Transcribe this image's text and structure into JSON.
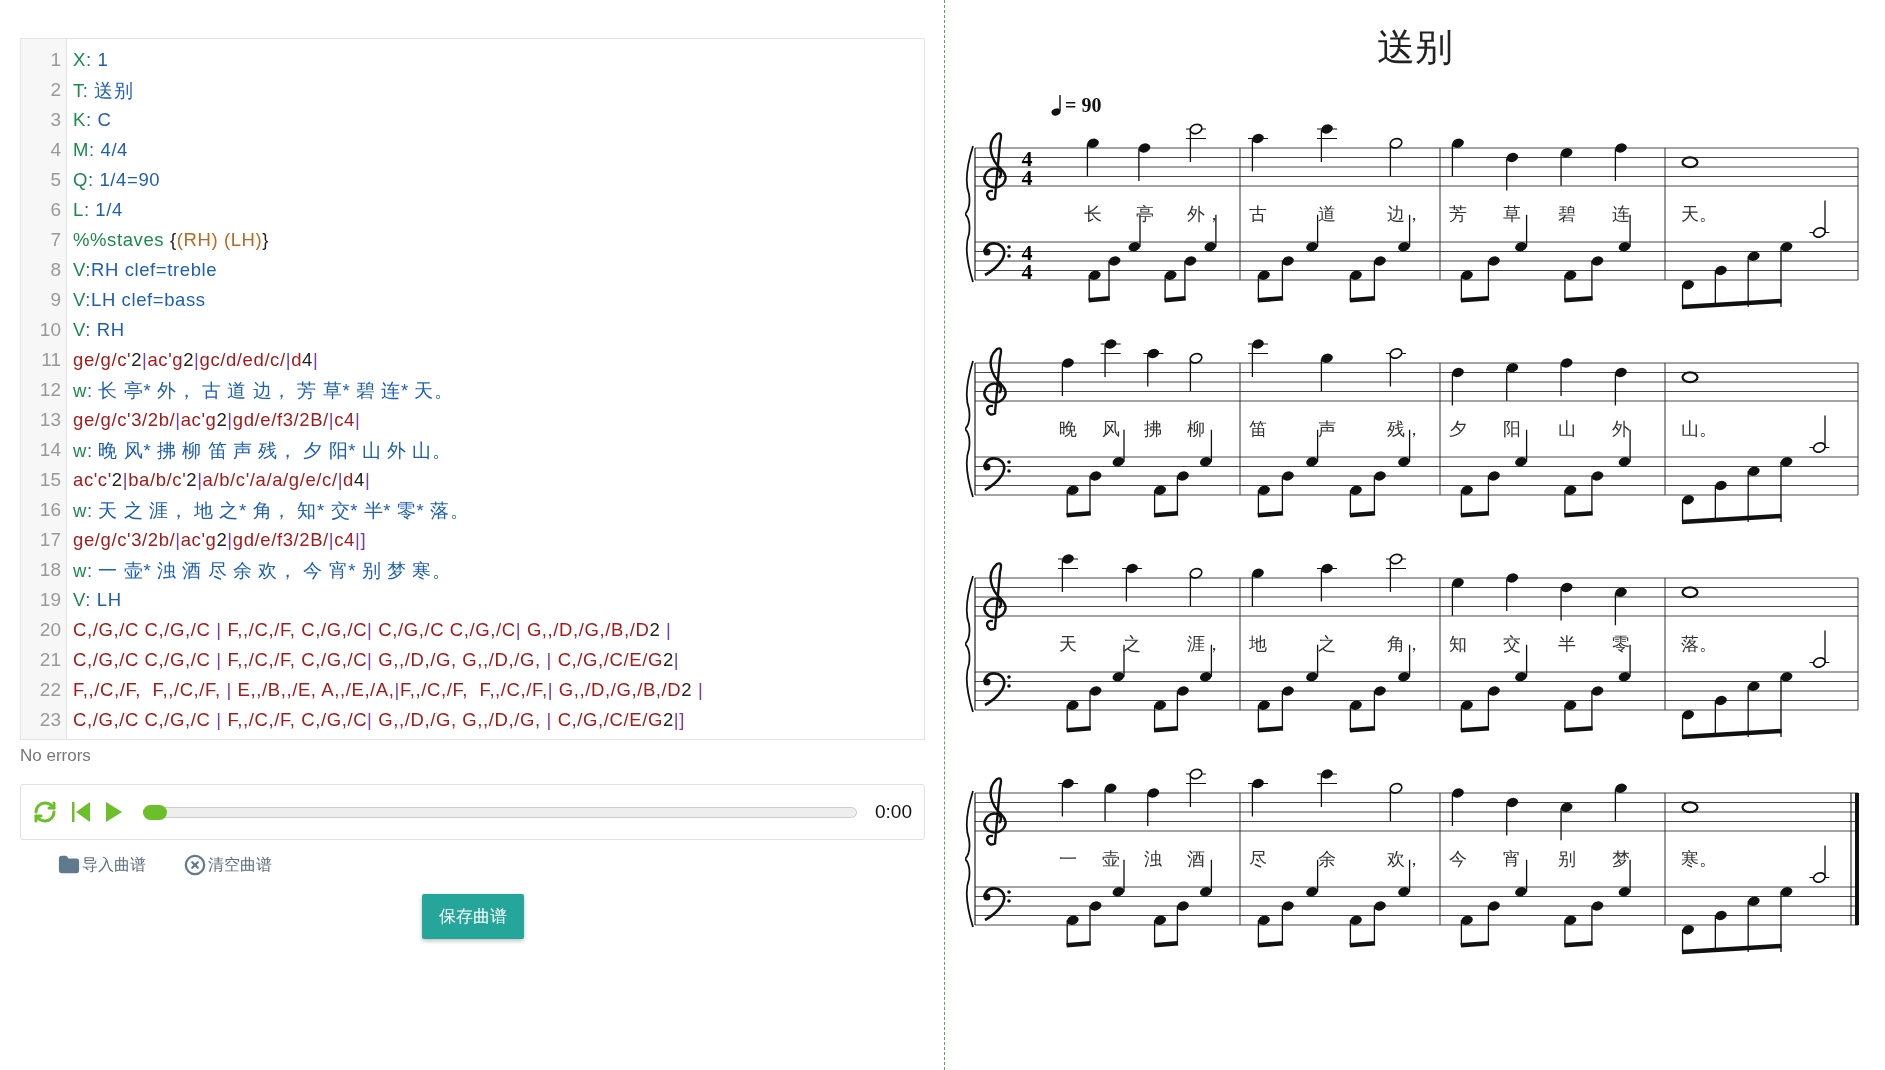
{
  "editor": {
    "lines": [
      {
        "number": "1",
        "segments": [
          {
            "kind": "key",
            "text": "X"
          },
          {
            "kind": "value",
            "text": ": 1"
          }
        ]
      },
      {
        "number": "2",
        "segments": [
          {
            "kind": "key",
            "text": "T"
          },
          {
            "kind": "value",
            "text": ": 送别"
          }
        ]
      },
      {
        "number": "3",
        "segments": [
          {
            "kind": "key",
            "text": "K"
          },
          {
            "kind": "value",
            "text": ": C"
          }
        ]
      },
      {
        "number": "4",
        "segments": [
          {
            "kind": "key",
            "text": "M"
          },
          {
            "kind": "value",
            "text": ": 4/4"
          }
        ]
      },
      {
        "number": "5",
        "segments": [
          {
            "kind": "key",
            "text": "Q"
          },
          {
            "kind": "value",
            "text": ": 1/4=90"
          }
        ]
      },
      {
        "number": "6",
        "segments": [
          {
            "kind": "key",
            "text": "L"
          },
          {
            "kind": "value",
            "text": ": 1/4"
          }
        ]
      },
      {
        "number": "7",
        "segments": [
          {
            "kind": "key",
            "text": "%%staves"
          },
          {
            "kind": "plain",
            "text": " {"
          },
          {
            "kind": "voice",
            "text": "(RH) (LH)"
          },
          {
            "kind": "plain",
            "text": "}"
          }
        ]
      },
      {
        "number": "8",
        "segments": [
          {
            "kind": "key",
            "text": "V"
          },
          {
            "kind": "value",
            "text": ":RH clef=treble"
          }
        ]
      },
      {
        "number": "9",
        "segments": [
          {
            "kind": "key",
            "text": "V"
          },
          {
            "kind": "value",
            "text": ":LH clef=bass"
          }
        ]
      },
      {
        "number": "10",
        "segments": [
          {
            "kind": "key",
            "text": "V"
          },
          {
            "kind": "value",
            "text": ": RH"
          }
        ]
      },
      {
        "number": "11",
        "segments": [
          {
            "kind": "note",
            "text": "ge/g/c'"
          },
          {
            "kind": "plain",
            "text": "2"
          },
          {
            "kind": "bar",
            "text": "|"
          },
          {
            "kind": "note",
            "text": "ac'g"
          },
          {
            "kind": "plain",
            "text": "2"
          },
          {
            "kind": "bar",
            "text": "|"
          },
          {
            "kind": "note",
            "text": "gc/d/ed/c/"
          },
          {
            "kind": "bar",
            "text": "|"
          },
          {
            "kind": "note",
            "text": "d"
          },
          {
            "kind": "plain",
            "text": "4"
          },
          {
            "kind": "bar",
            "text": "|"
          }
        ]
      },
      {
        "number": "12",
        "segments": [
          {
            "kind": "key",
            "text": "w"
          },
          {
            "kind": "value",
            "text": ": 长 亭* 外， 古 道 边， 芳 草* 碧 连* 天。"
          }
        ]
      },
      {
        "number": "13",
        "segments": [
          {
            "kind": "note",
            "text": "ge/g/c'3/2b/"
          },
          {
            "kind": "bar",
            "text": "|"
          },
          {
            "kind": "note",
            "text": "ac'g"
          },
          {
            "kind": "plain",
            "text": "2"
          },
          {
            "kind": "bar",
            "text": "|"
          },
          {
            "kind": "note",
            "text": "gd/e/f3/2B/"
          },
          {
            "kind": "bar",
            "text": "|"
          },
          {
            "kind": "note",
            "text": "c4"
          },
          {
            "kind": "bar",
            "text": "|"
          }
        ]
      },
      {
        "number": "14",
        "segments": [
          {
            "kind": "key",
            "text": "w"
          },
          {
            "kind": "value",
            "text": ": 晚 风* 拂 柳 笛 声 残， 夕 阳* 山 外 山。"
          }
        ]
      },
      {
        "number": "15",
        "segments": [
          {
            "kind": "note",
            "text": "ac'c'"
          },
          {
            "kind": "plain",
            "text": "2"
          },
          {
            "kind": "bar",
            "text": "|"
          },
          {
            "kind": "note",
            "text": "ba/b/c'"
          },
          {
            "kind": "plain",
            "text": "2"
          },
          {
            "kind": "bar",
            "text": "|"
          },
          {
            "kind": "note",
            "text": "a/b/c'/a/a/g/e/c/"
          },
          {
            "kind": "bar",
            "text": "|"
          },
          {
            "kind": "note",
            "text": "d"
          },
          {
            "kind": "plain",
            "text": "4"
          },
          {
            "kind": "bar",
            "text": "|"
          }
        ]
      },
      {
        "number": "16",
        "segments": [
          {
            "kind": "key",
            "text": "w"
          },
          {
            "kind": "value",
            "text": ": 天 之 涯， 地 之* 角， 知* 交* 半* 零* 落。"
          }
        ]
      },
      {
        "number": "17",
        "segments": [
          {
            "kind": "note",
            "text": "ge/g/c'3/2b/"
          },
          {
            "kind": "bar",
            "text": "|"
          },
          {
            "kind": "note",
            "text": "ac'g"
          },
          {
            "kind": "plain",
            "text": "2"
          },
          {
            "kind": "bar",
            "text": "|"
          },
          {
            "kind": "note",
            "text": "gd/e/f3/2B/"
          },
          {
            "kind": "bar",
            "text": "|"
          },
          {
            "kind": "note",
            "text": "c4"
          },
          {
            "kind": "bar",
            "text": "|]"
          }
        ]
      },
      {
        "number": "18",
        "segments": [
          {
            "kind": "key",
            "text": "w"
          },
          {
            "kind": "value",
            "text": ": 一 壶* 浊 酒 尽 余 欢， 今 宵* 别 梦 寒。"
          }
        ]
      },
      {
        "number": "19",
        "segments": [
          {
            "kind": "key",
            "text": "V"
          },
          {
            "kind": "value",
            "text": ": LH"
          }
        ]
      },
      {
        "number": "20",
        "segments": [
          {
            "kind": "note",
            "text": "C,/G,/C C,/G,/C "
          },
          {
            "kind": "bar",
            "text": "|"
          },
          {
            "kind": "note",
            "text": " F,,/C,/F, C,/G,/C"
          },
          {
            "kind": "bar",
            "text": "|"
          },
          {
            "kind": "note",
            "text": " C,/G,/C C,/G,/C"
          },
          {
            "kind": "bar",
            "text": "|"
          },
          {
            "kind": "note",
            "text": " G,,/D,/G,/B,/D"
          },
          {
            "kind": "plain",
            "text": "2 "
          },
          {
            "kind": "bar",
            "text": "|"
          }
        ]
      },
      {
        "number": "21",
        "segments": [
          {
            "kind": "note",
            "text": "C,/G,/C C,/G,/C "
          },
          {
            "kind": "bar",
            "text": "|"
          },
          {
            "kind": "note",
            "text": " F,,/C,/F, C,/G,/C"
          },
          {
            "kind": "bar",
            "text": "|"
          },
          {
            "kind": "note",
            "text": " G,,/D,/G, G,,/D,/G, "
          },
          {
            "kind": "bar",
            "text": "|"
          },
          {
            "kind": "note",
            "text": " C,/G,/C/E/G"
          },
          {
            "kind": "plain",
            "text": "2"
          },
          {
            "kind": "bar",
            "text": "|"
          }
        ]
      },
      {
        "number": "22",
        "segments": [
          {
            "kind": "note",
            "text": "F,,/C,/F,  F,,/C,/F, "
          },
          {
            "kind": "bar",
            "text": "|"
          },
          {
            "kind": "note",
            "text": " E,,/B,,/E, A,,/E,/A,"
          },
          {
            "kind": "bar",
            "text": "|"
          },
          {
            "kind": "note",
            "text": "F,,/C,/F,  F,,/C,/F,"
          },
          {
            "kind": "bar",
            "text": "|"
          },
          {
            "kind": "note",
            "text": " G,,/D,/G,/B,/D"
          },
          {
            "kind": "plain",
            "text": "2 "
          },
          {
            "kind": "bar",
            "text": "|"
          }
        ]
      },
      {
        "number": "23",
        "segments": [
          {
            "kind": "note",
            "text": "C,/G,/C C,/G,/C "
          },
          {
            "kind": "bar",
            "text": "|"
          },
          {
            "kind": "note",
            "text": " F,,/C,/F, C,/G,/C"
          },
          {
            "kind": "bar",
            "text": "|"
          },
          {
            "kind": "note",
            "text": " G,,/D,/G, G,,/D,/G, "
          },
          {
            "kind": "bar",
            "text": "|"
          },
          {
            "kind": "note",
            "text": " C,/G,/C/E/G"
          },
          {
            "kind": "plain",
            "text": "2"
          },
          {
            "kind": "bar",
            "text": "|]"
          }
        ]
      }
    ]
  },
  "status": "No errors",
  "player": {
    "level": 0,
    "time": "0:00"
  },
  "actions": [
    {
      "kind": "import",
      "label": "导入曲谱"
    },
    {
      "kind": "clear",
      "label": "清空曲谱"
    }
  ],
  "save_button": "保存曲谱",
  "score": {
    "title": "送别",
    "tempo": "= 90",
    "systems": [
      {
        "time_signatures": [
          {
            "upper": "4",
            "lower": "4"
          },
          {
            "upper": "4",
            "lower": "4"
          }
        ],
        "measures": [
          {
            "lyrics": [
              "长",
              "亭",
              "外，"
            ]
          },
          {
            "lyrics": [
              "古",
              "道",
              "边，"
            ]
          },
          {
            "lyrics": [
              "芳",
              "草",
              "碧",
              "连"
            ]
          },
          {
            "lyrics": [
              "天。"
            ]
          }
        ]
      },
      {
        "measures": [
          {
            "lyrics": [
              "晚",
              "风",
              "拂",
              "柳"
            ]
          },
          {
            "lyrics": [
              "笛",
              "声",
              "残，"
            ]
          },
          {
            "lyrics": [
              "夕",
              "阳",
              "山",
              "外"
            ]
          },
          {
            "lyrics": [
              "山。"
            ]
          }
        ]
      },
      {
        "measures": [
          {
            "lyrics": [
              "天",
              "之",
              "涯，"
            ]
          },
          {
            "lyrics": [
              "地",
              "之",
              "角，"
            ]
          },
          {
            "lyrics": [
              "知",
              "交",
              "半",
              "零"
            ]
          },
          {
            "lyrics": [
              "落。"
            ]
          }
        ]
      },
      {
        "end_bar": true,
        "measures": [
          {
            "lyrics": [
              "一",
              "壶",
              "浊",
              "酒"
            ]
          },
          {
            "lyrics": [
              "尽",
              "余",
              "欢，"
            ]
          },
          {
            "lyrics": [
              "今",
              "宵",
              "别",
              "梦"
            ]
          },
          {
            "lyrics": [
              "寒。"
            ]
          }
        ]
      }
    ]
  }
}
